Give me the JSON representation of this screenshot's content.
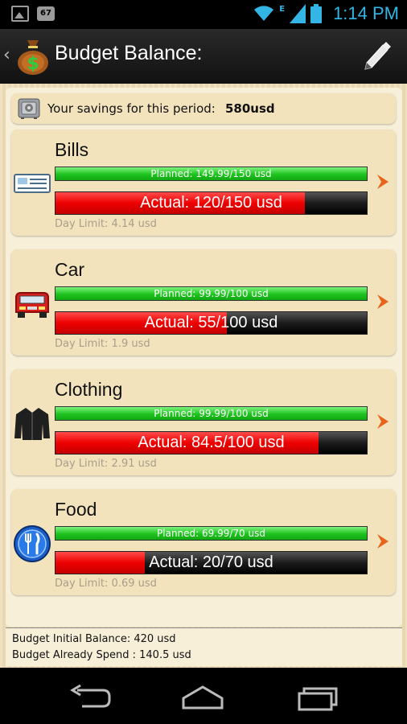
{
  "status_bar": {
    "notification_badge": "67",
    "network_type": "E",
    "time": "1:14 PM",
    "icons": [
      "gallery-icon",
      "badge-icon",
      "wifi-icon",
      "signal-icon",
      "battery-icon"
    ]
  },
  "action_bar": {
    "title": "Budget Balance:",
    "app_icon": "money-bag-icon",
    "edit_icon": "pencil-icon"
  },
  "savings": {
    "label": "Your savings for this period:",
    "value": "580usd",
    "icon": "safe-icon"
  },
  "categories": [
    {
      "name": "Bills",
      "icon": "bills-icon",
      "planned": "Planned: 149.99/150 usd",
      "actual": "Actual: 120/150 usd",
      "actual_fraction": 0.8,
      "day_limit": "Day Limit: 4.14 usd"
    },
    {
      "name": "Car",
      "icon": "car-icon",
      "planned": "Planned: 99.99/100 usd",
      "actual": "Actual: 55/100 usd",
      "actual_fraction": 0.55,
      "day_limit": "Day Limit: 1.9 usd"
    },
    {
      "name": "Clothing",
      "icon": "jacket-icon",
      "planned": "Planned: 99.99/100 usd",
      "actual": "Actual: 84.5/100 usd",
      "actual_fraction": 0.845,
      "day_limit": "Day Limit: 2.91 usd"
    },
    {
      "name": "Food",
      "icon": "fork-knife-icon",
      "planned": "Planned: 69.99/70 usd",
      "actual": "Actual: 20/70 usd",
      "actual_fraction": 0.2857,
      "day_limit": "Day Limit: 0.69 usd"
    }
  ],
  "footer": {
    "initial_balance": "Budget Initial Balance: 420 usd",
    "already_spend": "Budget Already Spend : 140.5 usd"
  },
  "colors": {
    "accent_blue": "#33b5e5",
    "planned_green": "#1fc21f",
    "actual_red": "#ee0000",
    "arrow_orange": "#e8641b",
    "card_bg": "#f3e3bd"
  }
}
